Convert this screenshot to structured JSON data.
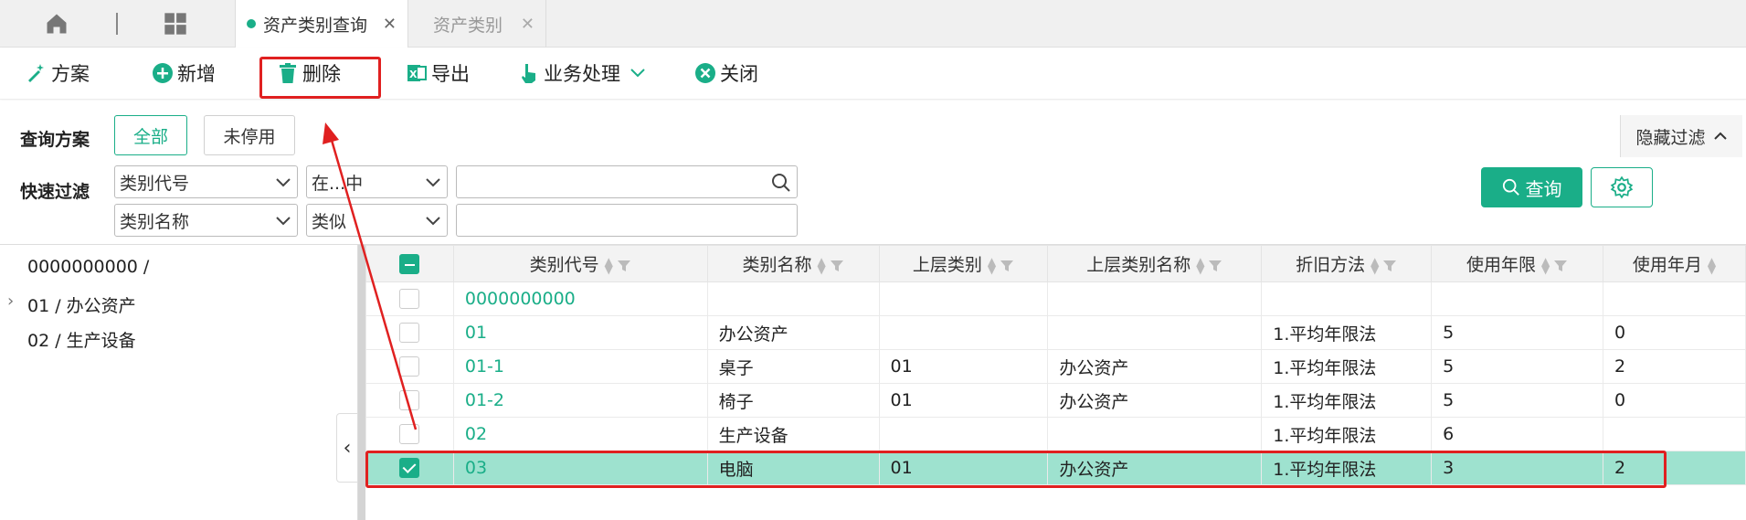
{
  "tabs": {
    "active_label": "资产类别查询",
    "inactive_label": "资产类别",
    "close": "✕"
  },
  "toolbar": {
    "scheme": "方案",
    "add": "新增",
    "delete": "删除",
    "export": "导出",
    "business": "业务处理",
    "close": "关闭"
  },
  "filter": {
    "query_scheme_label": "查询方案",
    "all_label": "全部",
    "not_disabled_label": "未停用",
    "quick_filter_label": "快速过滤",
    "field1": "类别代号",
    "op1": "在...中",
    "field2": "类别名称",
    "op2": "类似",
    "hide_filter": "隐藏过滤",
    "query_button": "查询"
  },
  "tree": {
    "items": [
      "0000000000 /",
      "01 / 办公资产",
      "02 / 生产设备"
    ]
  },
  "grid": {
    "columns": [
      "类别代号",
      "类别名称",
      "上层类别",
      "上层类别名称",
      "折旧方法",
      "使用年限",
      "使用年月"
    ],
    "rows": [
      [
        "0000000000",
        "",
        "",
        "",
        "",
        "",
        ""
      ],
      [
        "01",
        "办公资产",
        "",
        "",
        "1.平均年限法",
        "5",
        "0"
      ],
      [
        "01-1",
        "桌子",
        "01",
        "办公资产",
        "1.平均年限法",
        "5",
        "2"
      ],
      [
        "01-2",
        "椅子",
        "01",
        "办公资产",
        "1.平均年限法",
        "5",
        "0"
      ],
      [
        "02",
        "生产设备",
        "",
        "",
        "1.平均年限法",
        "6",
        ""
      ],
      [
        "03",
        "电脑",
        "01",
        "办公资产",
        "1.平均年限法",
        "3",
        "2"
      ]
    ]
  },
  "colors": {
    "accent": "#1aae88",
    "selected_row": "#9ee2cf",
    "highlight": "#e02020"
  }
}
